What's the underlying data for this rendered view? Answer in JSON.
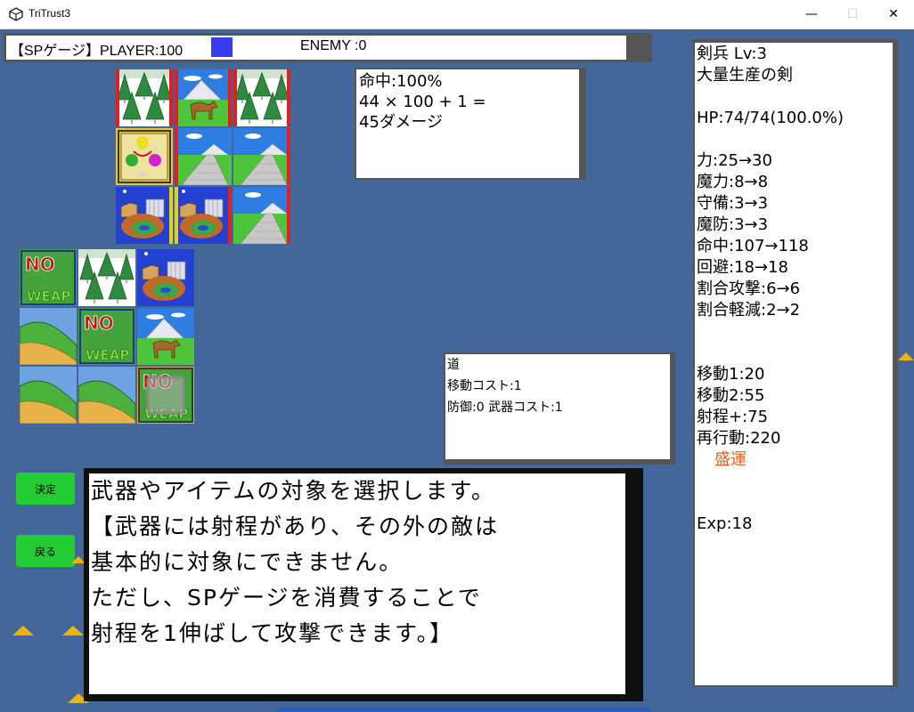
{
  "window": {
    "title": "TriTrust3",
    "minimize_label": "—",
    "maximize_label": "☐",
    "close_label": "✕"
  },
  "sp_gauge": {
    "player_text": "【SPゲージ】PLAYER:100",
    "player_value": 100,
    "enemy_text": "ENEMY :0",
    "enemy_value": 0,
    "player_color": "#3a3af0"
  },
  "damage_panel": {
    "lines": [
      "命中:100%",
      "44 × 100 + 1 =",
      "45ダメージ"
    ]
  },
  "terrain_panel": {
    "lines": [
      "道",
      "移動コスト:1",
      "防御:0 武器コスト:1"
    ]
  },
  "unit_panel": {
    "lines": [
      "剣兵 Lv:3",
      "大量生産の剣",
      "",
      "HP:74/74(100.0%)",
      "",
      "力:25→30",
      "魔力:8→8",
      "守備:3→3",
      "魔防:3→3",
      "命中:107→118",
      "回避:18→18",
      "割合攻撃:6→6",
      "割合軽減:2→2",
      "",
      "",
      "移動1:20",
      "移動2:55",
      "射程+:75",
      "再行動:220",
      "盛運",
      "",
      "",
      "Exp:18"
    ],
    "skill_color": "#e8601c"
  },
  "buttons": {
    "confirm_label": "決定",
    "back_label": "戻る"
  },
  "message": {
    "lines": [
      "武器やアイテムの対象を選択します。",
      "【武器には射程があり、その外の敵は",
      "基本的に対象にできません。",
      "ただし、SPゲージを消費することで",
      "射程を1伸ばして攻撃できます。】"
    ]
  },
  "map": {
    "tile_icons": [
      "forest-tile",
      "horse-plains-tile",
      "road-tile",
      "castle-tile",
      "grass-hill-tile",
      "unit-marker-tile",
      "no-weapon-marker-tile",
      "target-cursor-tile"
    ],
    "no_weap_text": [
      "NO",
      "WEAP"
    ]
  }
}
